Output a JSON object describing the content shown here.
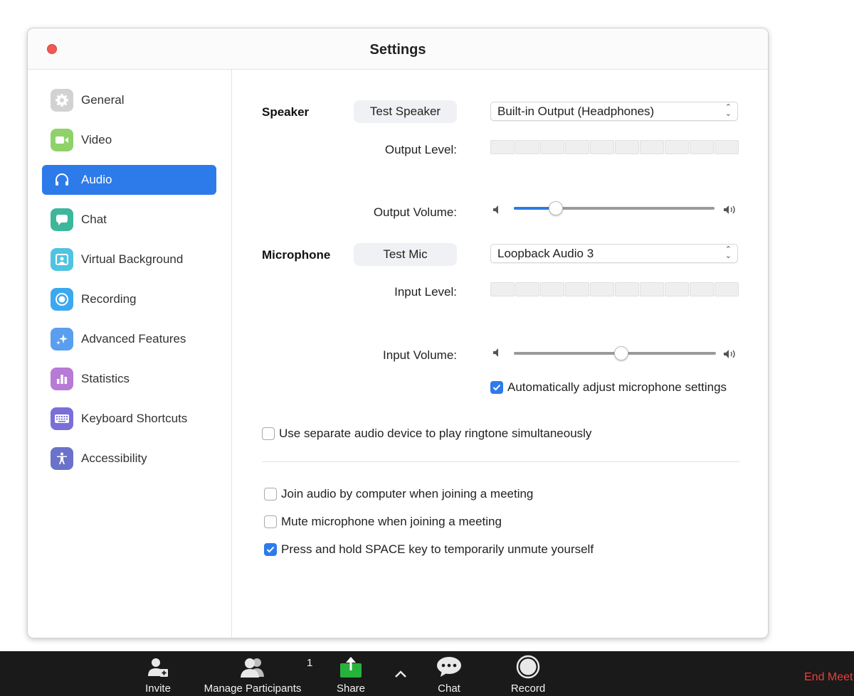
{
  "window": {
    "title": "Settings"
  },
  "sidebar": {
    "items": [
      {
        "label": "General",
        "icon": "gear-icon",
        "color": "#c9c9c9"
      },
      {
        "label": "Video",
        "icon": "video-camera-icon",
        "color": "#8fd26a"
      },
      {
        "label": "Audio",
        "icon": "headphones-icon",
        "color": "#2d7bea",
        "active": true
      },
      {
        "label": "Chat",
        "icon": "chat-bubble-icon",
        "color": "#3cb79b"
      },
      {
        "label": "Virtual Background",
        "icon": "person-portrait-icon",
        "color": "#4fc3e0"
      },
      {
        "label": "Recording",
        "icon": "record-icon",
        "color": "#3ba8f0"
      },
      {
        "label": "Advanced Features",
        "icon": "sparkle-icon",
        "color": "#5a9ef0"
      },
      {
        "label": "Statistics",
        "icon": "bar-chart-icon",
        "color": "#b77ad6"
      },
      {
        "label": "Keyboard Shortcuts",
        "icon": "keyboard-icon",
        "color": "#7a6fd9"
      },
      {
        "label": "Accessibility",
        "icon": "accessibility-icon",
        "color": "#6a72c9"
      }
    ]
  },
  "speaker": {
    "label": "Speaker",
    "test_button": "Test Speaker",
    "device": "Built-in Output (Headphones)",
    "output_level_label": "Output Level:",
    "output_volume_label": "Output Volume:",
    "volume_fraction": 0.21
  },
  "microphone": {
    "label": "Microphone",
    "test_button": "Test Mic",
    "device": "Loopback Audio 3",
    "input_level_label": "Input Level:",
    "input_volume_label": "Input Volume:",
    "volume_fraction": 0.53,
    "auto_adjust_label": "Automatically adjust microphone settings",
    "auto_adjust_checked": true
  },
  "options": {
    "separate_ringtone": {
      "label": "Use separate audio device to play ringtone simultaneously",
      "checked": false
    },
    "join_audio": {
      "label": "Join audio by computer when joining a meeting",
      "checked": false
    },
    "mute_on_join": {
      "label": "Mute microphone when joining a meeting",
      "checked": false
    },
    "space_unmute": {
      "label": "Press and hold SPACE key to temporarily unmute yourself",
      "checked": true
    }
  },
  "toolbar": {
    "invite": "Invite",
    "manage_participants": "Manage Participants",
    "participants_count": "1",
    "share": "Share",
    "chat": "Chat",
    "record": "Record",
    "end_meeting": "End Meet"
  },
  "colors": {
    "accent": "#2d7bea",
    "share_green": "#27b33b",
    "end_red": "#e8403a"
  }
}
